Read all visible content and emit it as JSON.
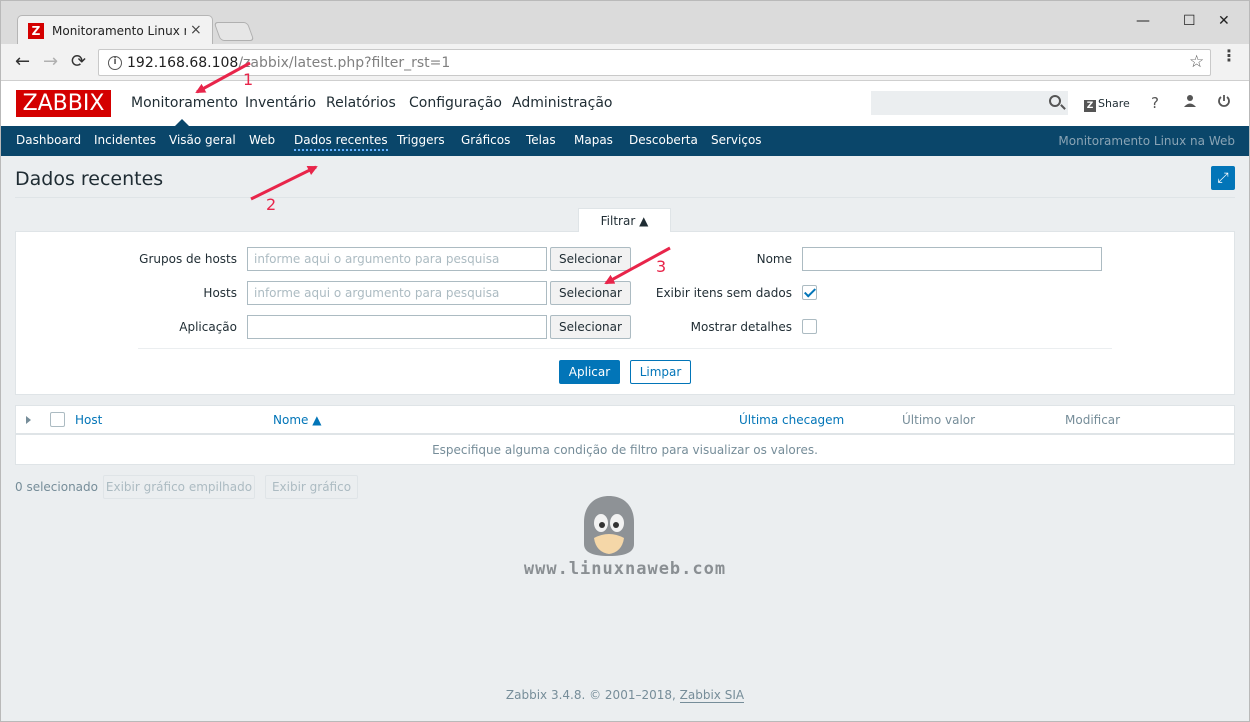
{
  "browser": {
    "tab_favicon": "Z",
    "tab_title": "Monitoramento Linux na",
    "tab_close": "×",
    "win_minimize": "—",
    "win_maximize": "☐",
    "win_close": "✕",
    "back": "←",
    "forward": "→",
    "reload": "⟳",
    "info_glyph": "i",
    "url_host": "192.168.68.108",
    "url_path": "/zabbix/latest.php?filter_rst=1",
    "star": "☆",
    "menu": "⋮"
  },
  "header": {
    "logo": "ZABBIX",
    "menu": [
      "Monitoramento",
      "Inventário",
      "Relatórios",
      "Configuração",
      "Administração"
    ],
    "active_menu": "Monitoramento",
    "search_placeholder": "",
    "share_badge": "Z",
    "share_label": "Share",
    "help": "?",
    "user_icon": "user-icon",
    "logout_icon": "power-icon"
  },
  "submenu": {
    "items": [
      "Dashboard",
      "Incidentes",
      "Visão geral",
      "Web",
      "Dados recentes",
      "Triggers",
      "Gráficos",
      "Telas",
      "Mapas",
      "Descoberta",
      "Serviços"
    ],
    "active": "Dados recentes",
    "right_text": "Monitoramento Linux na Web"
  },
  "page": {
    "title": "Dados recentes",
    "fullscreen_glyph": "⤢"
  },
  "filter": {
    "tab_label": "Filtrar ▲",
    "host_groups_label": "Grupos de hosts",
    "host_groups_placeholder": "informe aqui o argumento para pesquisa",
    "hosts_label": "Hosts",
    "hosts_placeholder": "informe aqui o argumento para pesquisa",
    "application_label": "Aplicação",
    "application_value": "",
    "select_label": "Selecionar",
    "name_label": "Nome",
    "name_value": "",
    "show_without_data_label": "Exibir itens sem dados",
    "show_without_data_checked": true,
    "show_details_label": "Mostrar detalhes",
    "show_details_checked": false,
    "apply_label": "Aplicar",
    "clear_label": "Limpar"
  },
  "table": {
    "columns": [
      "Host",
      "Nome ▲",
      "Última checagem",
      "Último valor",
      "Modificar"
    ],
    "empty_message": "Especifique alguma condição de filtro para visualizar os valores."
  },
  "actions": {
    "selected_count": "0 selecionado",
    "stacked_graph_label": "Exibir gráfico empilhado",
    "graph_label": "Exibir gráfico"
  },
  "watermark": "www.linuxnaweb.com",
  "footer": {
    "text": "Zabbix 3.4.8. © 2001–2018,",
    "link": "Zabbix SIA"
  },
  "annotations": {
    "labels": [
      "1",
      "2",
      "3"
    ],
    "color": "#e8254a"
  },
  "colors": {
    "brand_red": "#d40000",
    "nav_blue": "#0a466a",
    "accent_blue": "#0275b8"
  }
}
